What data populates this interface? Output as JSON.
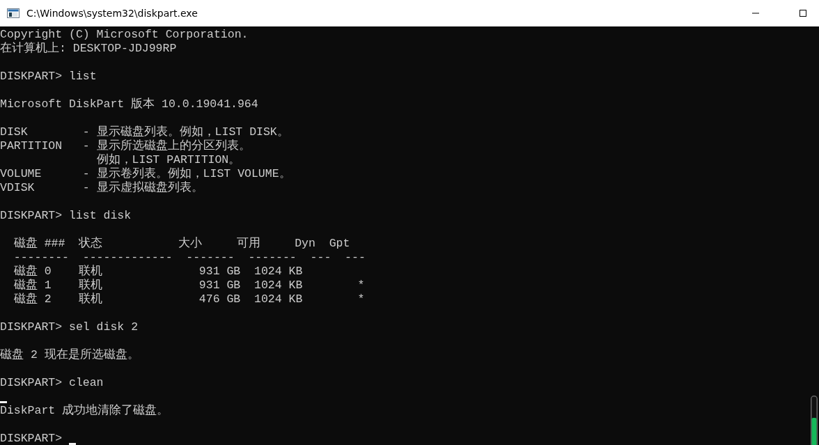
{
  "window": {
    "title": "C:\\Windows\\system32\\diskpart.exe"
  },
  "console": {
    "lines": [
      {
        "kind": "text",
        "text": "Copyright (C) Microsoft Corporation."
      },
      {
        "kind": "text",
        "text": "在计算机上: DESKTOP-JDJ99RP"
      },
      {
        "kind": "blank"
      },
      {
        "kind": "text",
        "text": "DISKPART> list"
      },
      {
        "kind": "blank"
      },
      {
        "kind": "text",
        "text": "Microsoft DiskPart 版本 10.0.19041.964"
      },
      {
        "kind": "blank"
      },
      {
        "kind": "text",
        "text": "DISK        - 显示磁盘列表。例如，LIST DISK。"
      },
      {
        "kind": "text",
        "text": "PARTITION   - 显示所选磁盘上的分区列表。"
      },
      {
        "kind": "text",
        "text": "              例如，LIST PARTITION。"
      },
      {
        "kind": "text",
        "text": "VOLUME      - 显示卷列表。例如，LIST VOLUME。"
      },
      {
        "kind": "text",
        "text": "VDISK       - 显示虚拟磁盘列表。"
      },
      {
        "kind": "blank"
      },
      {
        "kind": "text",
        "text": "DISKPART> list disk"
      },
      {
        "kind": "blank"
      },
      {
        "kind": "text",
        "text": "  磁盘 ###  状态           大小     可用     Dyn  Gpt"
      },
      {
        "kind": "text",
        "text": "  --------  -------------  -------  -------  ---  ---"
      },
      {
        "kind": "text",
        "text": "  磁盘 0    联机              931 GB  1024 KB"
      },
      {
        "kind": "text",
        "text": "  磁盘 1    联机              931 GB  1024 KB        *"
      },
      {
        "kind": "text",
        "text": "  磁盘 2    联机              476 GB  1024 KB        *"
      },
      {
        "kind": "blank"
      },
      {
        "kind": "text",
        "text": "DISKPART> sel disk 2"
      },
      {
        "kind": "blank"
      },
      {
        "kind": "text",
        "text": "磁盘 2 现在是所选磁盘。"
      },
      {
        "kind": "blank"
      },
      {
        "kind": "text",
        "text": "DISKPART> clean"
      },
      {
        "kind": "cursor"
      },
      {
        "kind": "text",
        "text": "DiskPart 成功地清除了磁盘。"
      },
      {
        "kind": "blank"
      },
      {
        "kind": "input",
        "text": "DISKPART>"
      }
    ]
  }
}
